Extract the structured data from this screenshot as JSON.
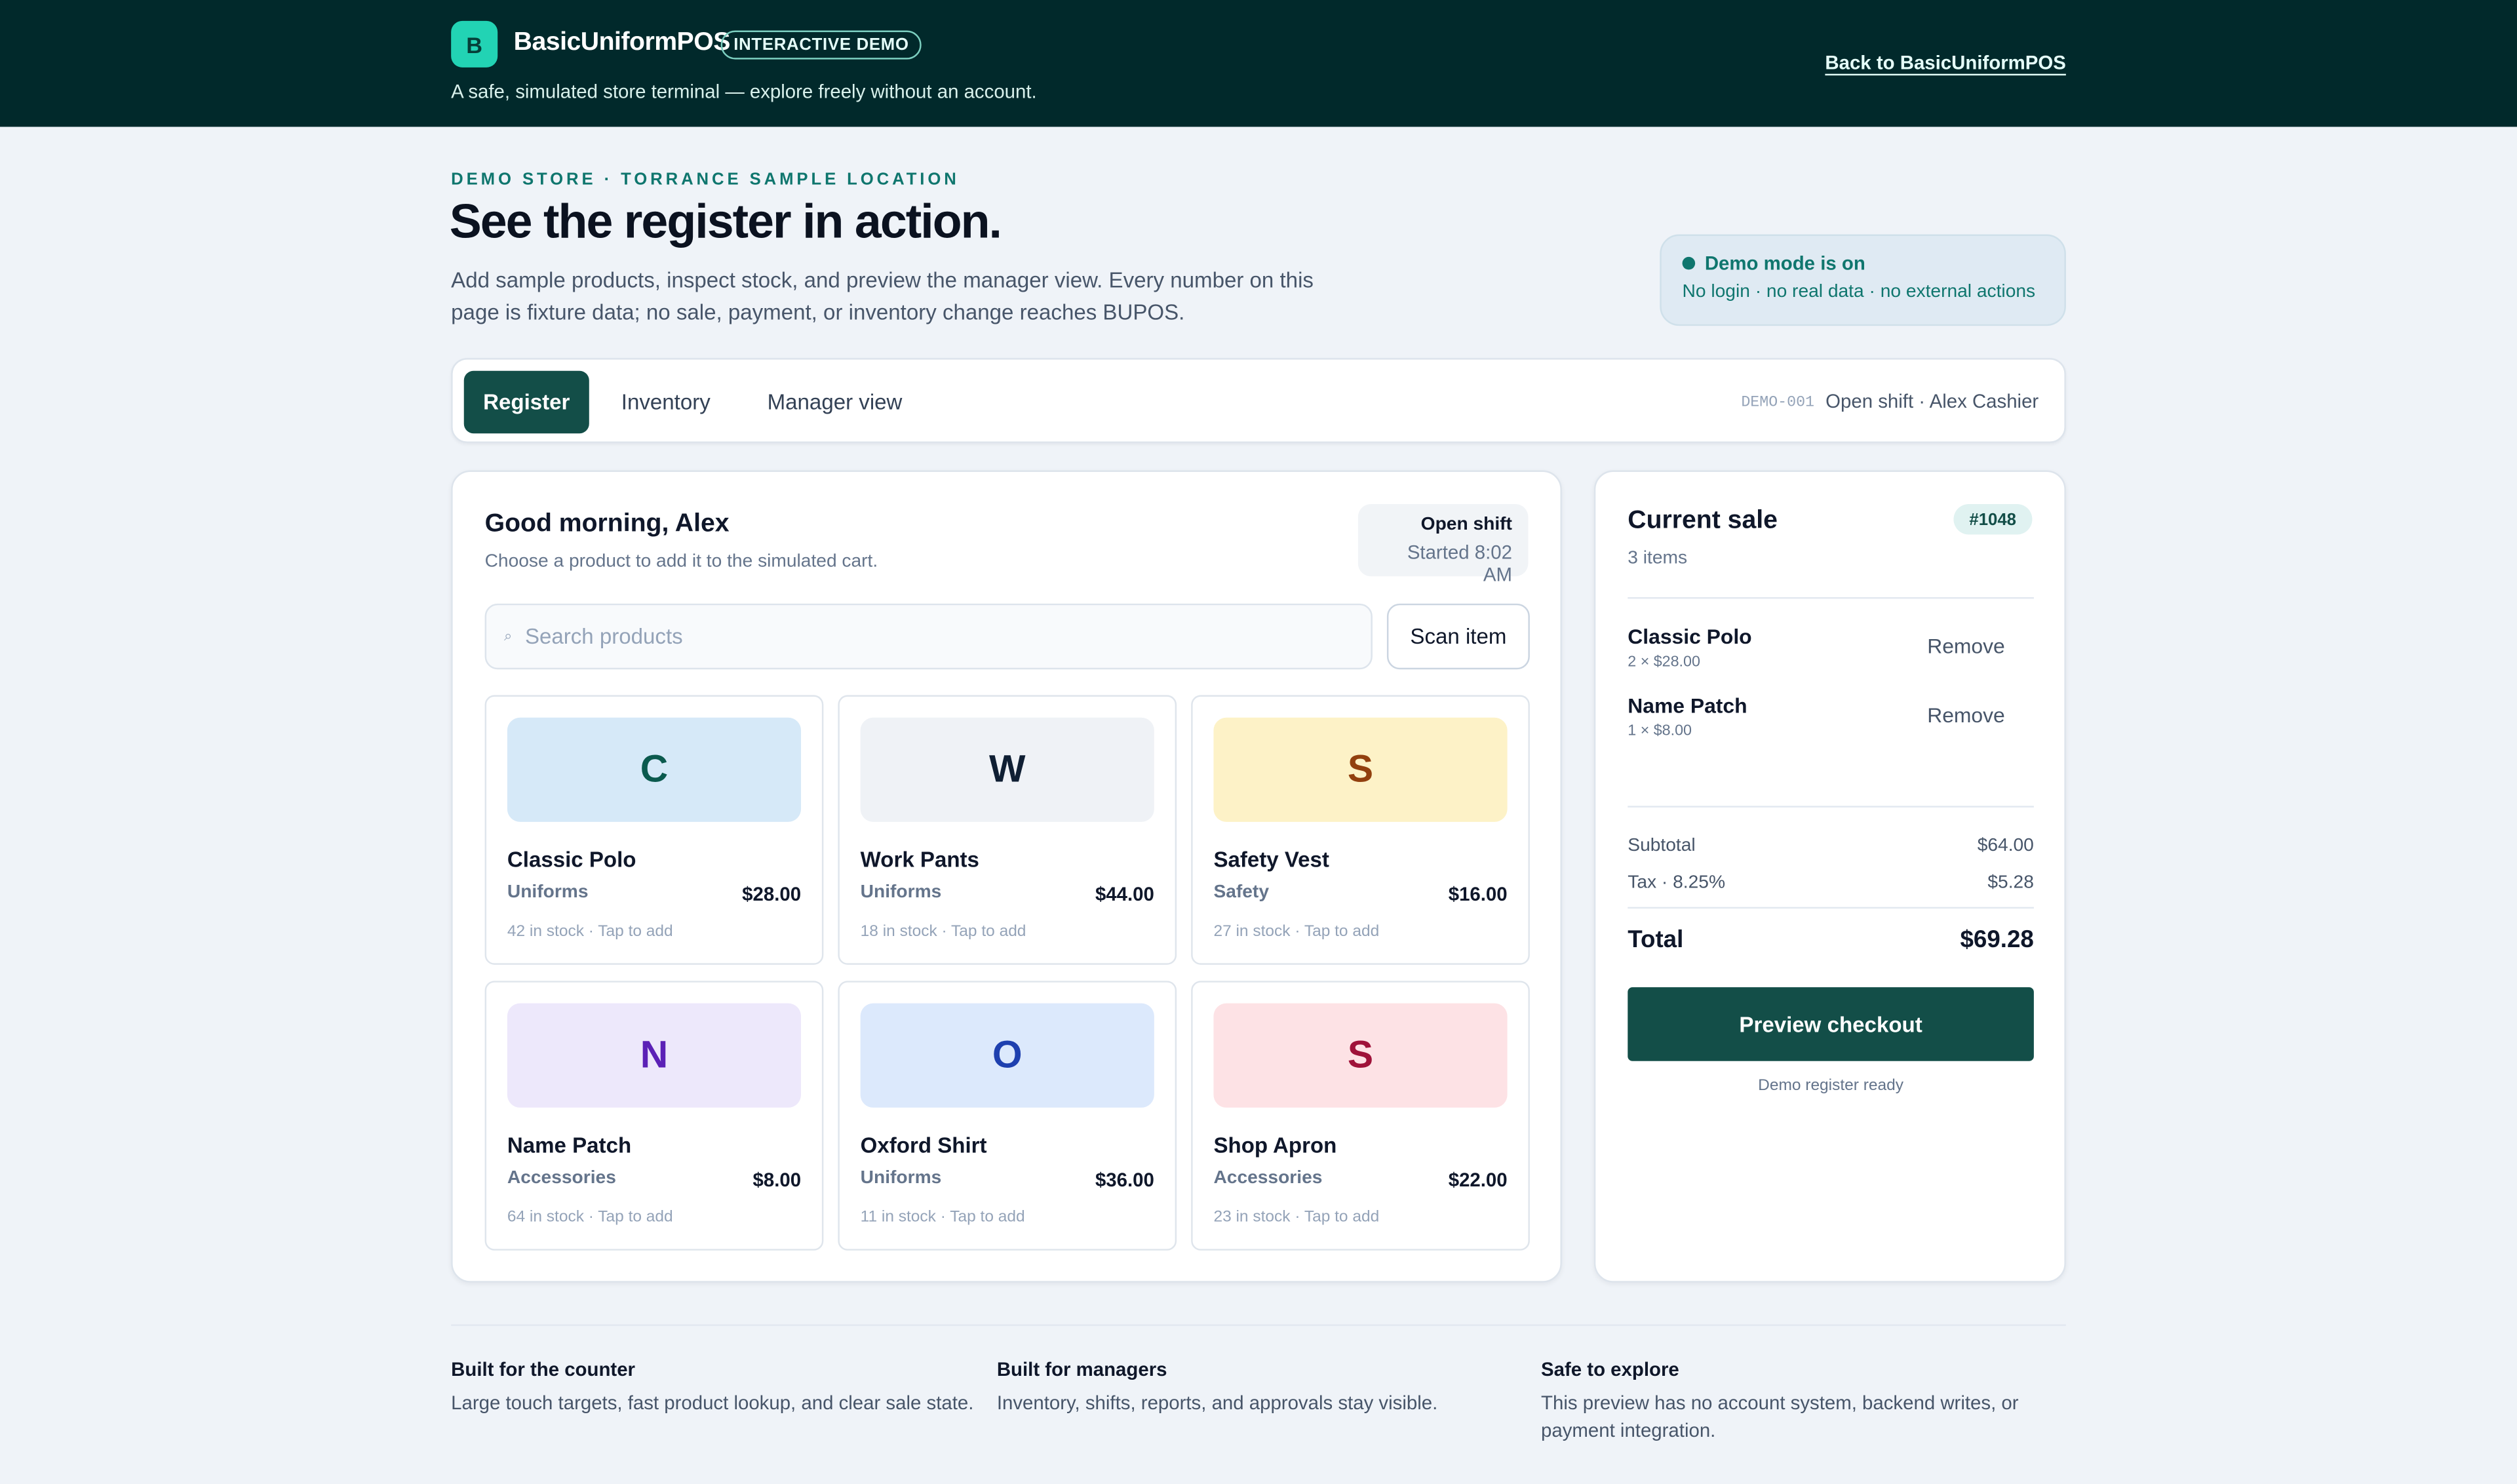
{
  "header": {
    "logo_letter": "B",
    "brand": "BasicUniformPOS",
    "badge": "INTERACTIVE DEMO",
    "tagline": "A safe, simulated store terminal — explore freely without an account.",
    "back_link": "Back to BasicUniformPOS"
  },
  "hero": {
    "eyebrow": "DEMO STORE · TORRANCE SAMPLE LOCATION",
    "title": "See the register in action.",
    "description": "Add sample products, inspect stock, and preview the manager view. Every number on this page is fixture data; no sale, payment, or inventory change reaches BUPOS."
  },
  "demo_mode": {
    "title": "Demo mode is on",
    "subtitle": "No login · no real data · no external actions"
  },
  "tabs": [
    {
      "label": "Register",
      "active": true
    },
    {
      "label": "Inventory",
      "active": false
    },
    {
      "label": "Manager view",
      "active": false
    }
  ],
  "shift_bar": {
    "code": "DEMO-001",
    "text": "Open shift · Alex Cashier"
  },
  "register": {
    "greeting": "Good morning, Alex",
    "subtitle": "Choose a product to add it to the simulated cart.",
    "shift_title": "Open shift",
    "shift_started": "Started 8:02 AM",
    "search_placeholder": "Search products",
    "search_icon": "search-icon",
    "scan_label": "Scan item",
    "products": [
      {
        "letter": "C",
        "name": "Classic Polo",
        "category": "Uniforms",
        "price": "$28.00",
        "stock": "42 in stock · Tap to add",
        "bg": "#d6e9f8",
        "fg": "#0b5a4e"
      },
      {
        "letter": "W",
        "name": "Work Pants",
        "category": "Uniforms",
        "price": "$44.00",
        "stock": "18 in stock · Tap to add",
        "bg": "#eff2f6",
        "fg": "#0f1f33"
      },
      {
        "letter": "S",
        "name": "Safety Vest",
        "category": "Safety",
        "price": "$16.00",
        "stock": "27 in stock · Tap to add",
        "bg": "#fdf2c7",
        "fg": "#92400e"
      },
      {
        "letter": "N",
        "name": "Name Patch",
        "category": "Accessories",
        "price": "$8.00",
        "stock": "64 in stock · Tap to add",
        "bg": "#ede8fb",
        "fg": "#5b21b6"
      },
      {
        "letter": "O",
        "name": "Oxford Shirt",
        "category": "Uniforms",
        "price": "$36.00",
        "stock": "11 in stock · Tap to add",
        "bg": "#dce9fc",
        "fg": "#1e40af"
      },
      {
        "letter": "S",
        "name": "Shop Apron",
        "category": "Accessories",
        "price": "$22.00",
        "stock": "23 in stock · Tap to add",
        "bg": "#fde2e5",
        "fg": "#9f1239"
      }
    ]
  },
  "sale": {
    "title": "Current sale",
    "order_no": "#1048",
    "count": "3 items",
    "items": [
      {
        "name": "Classic Polo",
        "qty": "2 × $28.00",
        "remove": "Remove"
      },
      {
        "name": "Name Patch",
        "qty": "1 × $8.00",
        "remove": "Remove"
      }
    ],
    "subtotal_label": "Subtotal",
    "subtotal": "$64.00",
    "tax_label": "Tax · 8.25%",
    "tax": "$5.28",
    "total_label": "Total",
    "total": "$69.28",
    "checkout_label": "Preview checkout",
    "ready_note": "Demo register ready"
  },
  "features": [
    {
      "title": "Built for the counter",
      "desc": "Large touch targets, fast product lookup, and clear sale state."
    },
    {
      "title": "Built for managers",
      "desc": "Inventory, shifts, reports, and approvals stay visible."
    },
    {
      "title": "Safe to explore",
      "desc": "This preview has no account system, backend writes, or payment integration."
    }
  ]
}
